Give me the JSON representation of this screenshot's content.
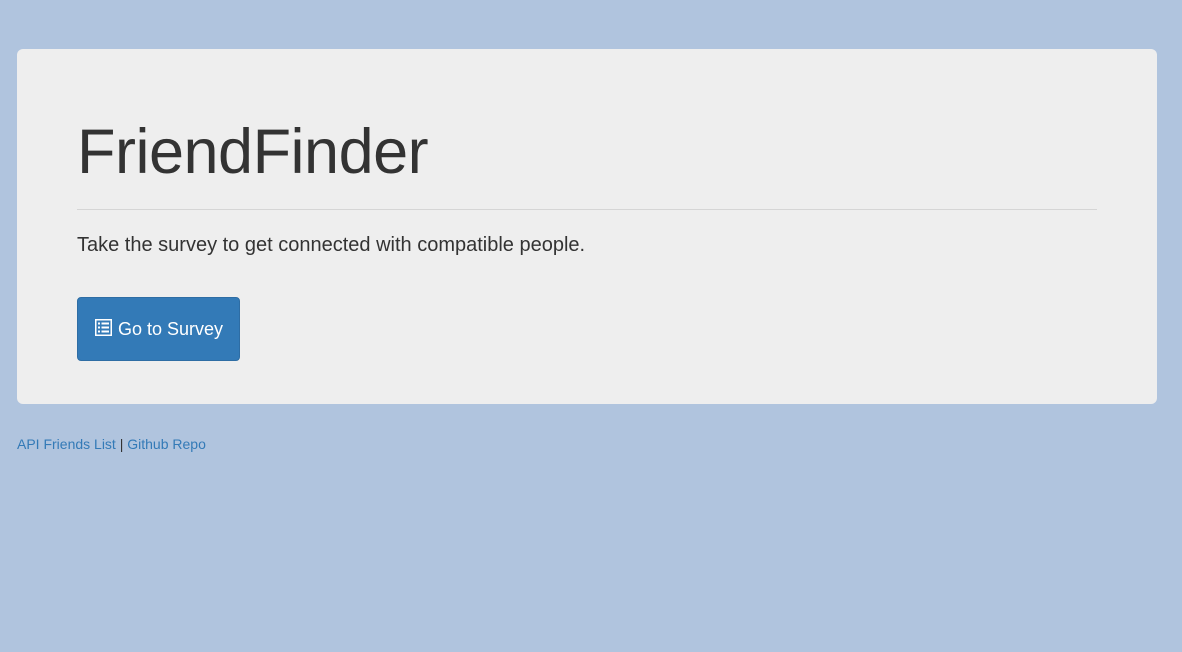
{
  "jumbotron": {
    "title": "FriendFinder",
    "lead": "Take the survey to get connected with compatible people.",
    "button_label": "Go to Survey",
    "button_icon": "list-alt-icon"
  },
  "footer": {
    "link_api": "API Friends List",
    "separator": "|",
    "link_github": "Github Repo"
  },
  "colors": {
    "page_background": "#b0c4de",
    "panel_background": "#eeeeee",
    "primary": "#337ab7",
    "text": "#333333"
  }
}
